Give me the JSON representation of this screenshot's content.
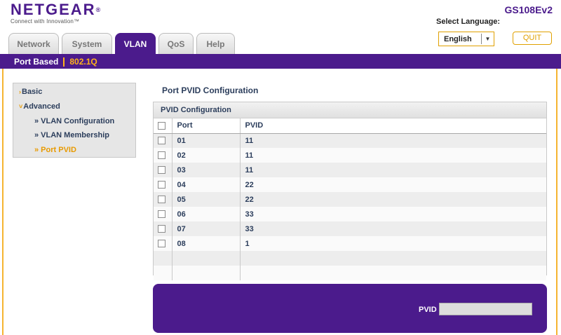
{
  "header": {
    "logo_text": "NETGEAR",
    "logo_tagline": "Connect with Innovation™",
    "model": "GS108Ev2",
    "language_label": "Select Language:",
    "language_value": "English",
    "quit_label": "QUIT"
  },
  "tabs": [
    {
      "label": "Network",
      "active": false
    },
    {
      "label": "System",
      "active": false
    },
    {
      "label": "VLAN",
      "active": true
    },
    {
      "label": "QoS",
      "active": false
    },
    {
      "label": "Help",
      "active": false
    }
  ],
  "sub_nav": {
    "items": [
      {
        "label": "Port Based",
        "active": false
      },
      {
        "label": "802.1Q",
        "active": true
      }
    ]
  },
  "menu": {
    "items": [
      {
        "label": "Basic",
        "bullet": "›"
      },
      {
        "label": "Advanced",
        "bullet": "˅"
      },
      {
        "label": "» VLAN Configuration"
      },
      {
        "label": "» VLAN Membership"
      },
      {
        "label": "» Port PVID"
      }
    ]
  },
  "main": {
    "title": "Port PVID Configuration",
    "panel_title": "PVID Configuration",
    "columns": [
      "Port",
      "PVID"
    ],
    "rows": [
      {
        "port": "01",
        "pvid": "11"
      },
      {
        "port": "02",
        "pvid": "11"
      },
      {
        "port": "03",
        "pvid": "11"
      },
      {
        "port": "04",
        "pvid": "22"
      },
      {
        "port": "05",
        "pvid": "22"
      },
      {
        "port": "06",
        "pvid": "33"
      },
      {
        "port": "07",
        "pvid": "33"
      },
      {
        "port": "08",
        "pvid": "1"
      }
    ],
    "pvid_label": "PVID",
    "pvid_value": ""
  },
  "colors": {
    "brand_purple": "#4b1b8c",
    "accent_orange": "#ffb21a",
    "text_navy": "#2c3e5c"
  }
}
